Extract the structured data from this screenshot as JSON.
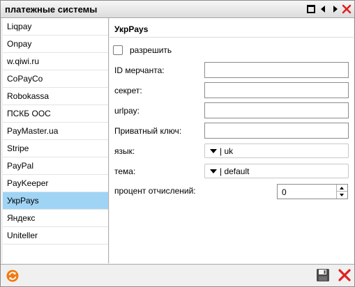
{
  "window": {
    "title": "платежные системы"
  },
  "sidebar": {
    "items": [
      {
        "label": "Liqpay"
      },
      {
        "label": "Onpay"
      },
      {
        "label": "w.qiwi.ru"
      },
      {
        "label": "CoPayCo"
      },
      {
        "label": "Robokassa"
      },
      {
        "label": "ПСКБ ООС"
      },
      {
        "label": "PayMaster.ua"
      },
      {
        "label": "Stripe"
      },
      {
        "label": "PayPal"
      },
      {
        "label": "PayKeeper"
      },
      {
        "label": "УкрPays"
      },
      {
        "label": "Яндекс"
      },
      {
        "label": "Uniteller"
      }
    ],
    "selected": "УкрPays"
  },
  "form": {
    "title": "УкрPays",
    "enable_label": "разрешить",
    "enable_checked": false,
    "merchant_id_label": "ID мерчанта:",
    "merchant_id_value": "",
    "secret_label": "секрет:",
    "secret_value": "",
    "urlpay_label": "urlpay:",
    "urlpay_value": "",
    "private_key_label": "Приватный ключ:",
    "private_key_value": "",
    "language_label": "язык:",
    "language_value": "| uk",
    "theme_label": "тема:",
    "theme_value": "| default",
    "percent_label": "процент отчислений:",
    "percent_value": "0"
  },
  "icons": {
    "maximize": "maximize-icon",
    "prev": "arrow-left-icon",
    "next": "arrow-right-icon",
    "close": "close-icon",
    "refresh": "refresh-icon",
    "save": "save-icon"
  },
  "colors": {
    "selected_row": "#9fd4f5",
    "close_red": "#e02020",
    "refresh_orange": "#f07a10"
  }
}
